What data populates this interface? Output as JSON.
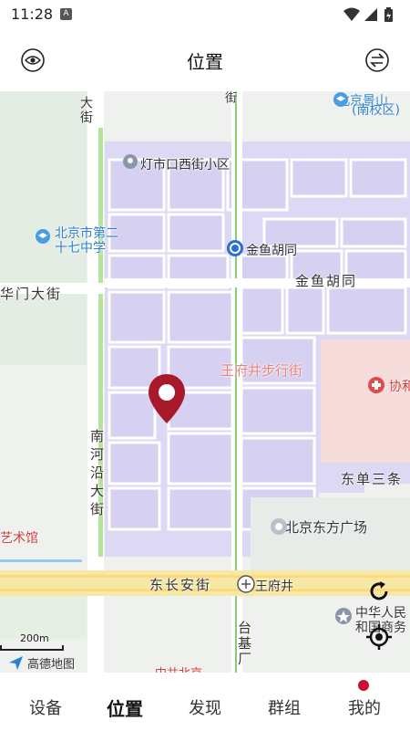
{
  "status_bar": {
    "time": "11:28",
    "notification_badge": "A",
    "icons": [
      "wifi-icon",
      "signal-icon",
      "battery-icon"
    ]
  },
  "header": {
    "title": "位置",
    "left_icon": "eye-icon",
    "right_icon": "switch-icon"
  },
  "map": {
    "labels": {
      "dajie": "大街",
      "jie_top": "街",
      "beijing_jingshan": "北京景山",
      "nanxiaoqu": "(南校区)",
      "dengshikou": "灯市口西街小区",
      "school_27_line1": "北京市第二",
      "school_27_line2": "十七中学",
      "jinyu_metro": "金鱼胡同",
      "jinyu_road": "金鱼胡同",
      "huamen": "华门大街",
      "wangfujing_walk": "王府井步行街",
      "xiehe": "协和",
      "nanheyan": "南河沿大街",
      "dongdan": "东单三条",
      "oriental_plaza": "北京东方广场",
      "art_museum": "艺术馆",
      "changan": "东长安街",
      "wangfujing_metro": "王府井",
      "taijichang": "台基厂",
      "commerce_line1": "中华人民",
      "commerce_line2": "和国商务",
      "bottom_red": "中共北京"
    },
    "scale": "200m",
    "brand": "高德地图",
    "pin_icon": "location-pin-icon",
    "refresh_icon": "refresh-icon",
    "locate_icon": "crosshair-locate-icon"
  },
  "bottom_nav": {
    "items": [
      {
        "label": "设备",
        "active": false
      },
      {
        "label": "位置",
        "active": true
      },
      {
        "label": "发现",
        "active": false
      },
      {
        "label": "群组",
        "active": false
      },
      {
        "label": "我的",
        "active": false
      }
    ],
    "badge_color": "#c8102e"
  }
}
